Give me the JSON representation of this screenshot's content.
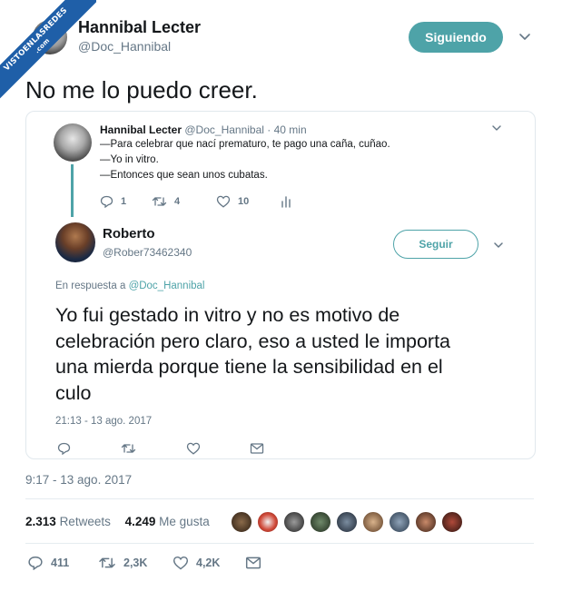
{
  "watermark": {
    "line1": "VISTOENLASREDES",
    "line2": ".com"
  },
  "author": {
    "name": "Hannibal Lecter",
    "handle": "@Doc_Hannibal",
    "follow_label": "Siguiendo"
  },
  "tweet": {
    "text": "No me lo puedo creer.",
    "timestamp": "9:17 - 13 ago. 2017",
    "retweets": "2.313",
    "retweets_label": "Retweets",
    "likes": "4.249",
    "likes_label": "Me gusta",
    "actions": {
      "reply_count": "411",
      "retweet_count": "2,3K",
      "like_count": "4,2K"
    }
  },
  "quoted": {
    "original": {
      "name": "Hannibal Lecter",
      "handle": "@Doc_Hannibal",
      "time": "· 40 min",
      "lines": [
        "—Para celebrar que nací prematuro, te pago una caña, cuñao.",
        "—Yo in vitro.",
        "—Entonces que sean unos cubatas."
      ],
      "reply_count": "1",
      "retweet_count": "4",
      "like_count": "10"
    },
    "reply": {
      "name": "Roberto",
      "handle": "@Rober73462340",
      "follow_label": "Seguir",
      "reply_prefix": "En respuesta a",
      "reply_to": "@Doc_Hannibal",
      "text_lines": [
        "Yo fui gestado in vitro y no es motivo de",
        "celebración pero claro, eso a usted le importa",
        "una mierda porque tiene la sensibilidad en el",
        "culo"
      ],
      "timestamp": "21:13 - 13 ago. 2017"
    }
  },
  "colors": {
    "accent": "#4ea3a8",
    "secondary_text": "#657786",
    "text": "#14171a",
    "border": "#e1e8ed",
    "ribbon": "#1f5fa8"
  },
  "icons": [
    "reply-icon",
    "retweet-icon",
    "like-icon",
    "analytics-icon",
    "message-icon",
    "chevron-down-icon"
  ]
}
